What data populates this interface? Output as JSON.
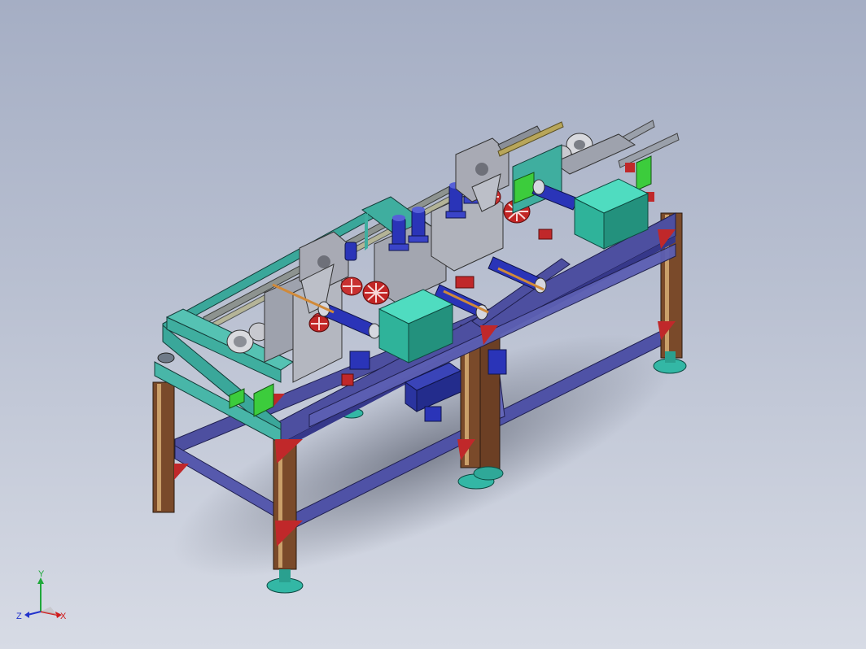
{
  "viewport": {
    "background_top": "#a5aec4",
    "background_bottom": "#d7dbe5"
  },
  "triad": {
    "x_label": "X",
    "y_label": "Y",
    "z_label": "Z",
    "x_color": "#d01b1b",
    "y_color": "#1fa83a",
    "z_color": "#2233cc"
  },
  "colors": {
    "frame_purple": "#4d4fa0",
    "frame_teal": "#3aa79a",
    "leg_brown": "#7a4a2a",
    "bracket_red": "#c0282a",
    "motor_blue": "#2a34b8",
    "box_teal": "#2fb39a",
    "plate_grey": "#9ea2ad",
    "rail_grey": "#8a8f98",
    "foot_cyan": "#33b7a5"
  }
}
